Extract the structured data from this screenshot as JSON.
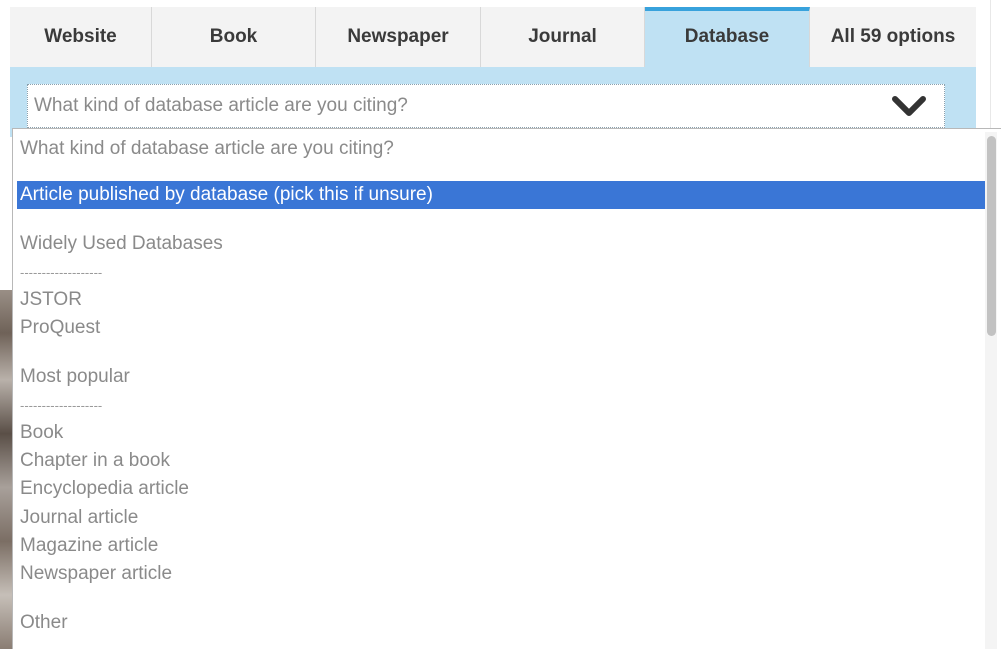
{
  "tabs": [
    {
      "label": "Website",
      "active": false
    },
    {
      "label": "Book",
      "active": false
    },
    {
      "label": "Newspaper",
      "active": false
    },
    {
      "label": "Journal",
      "active": false
    },
    {
      "label": "Database",
      "active": true
    },
    {
      "label": "All 59 options",
      "active": false
    }
  ],
  "select": {
    "placeholder": "What kind of database article are you citing?"
  },
  "dropdown": {
    "placeholder_option": "What kind of database article are you citing?",
    "selected_option": "Article published by database (pick this if unsure)",
    "group_widely_used": "Widely Used Databases",
    "separator_1": "-------------------",
    "jstor": "JSTOR",
    "proquest": "ProQuest",
    "group_most_popular": "Most popular",
    "separator_2": "-------------------",
    "book": "Book",
    "chapter": "Chapter in a book",
    "encyclopedia": "Encyclopedia article",
    "journal_article": "Journal article",
    "magazine_article": "Magazine article",
    "newspaper_article": "Newspaper article",
    "group_other": "Other"
  },
  "colors": {
    "active_tab_bg": "#bfe1f3",
    "active_tab_border": "#38a2dc",
    "selected_option_bg": "#3a76d6"
  },
  "icons": {
    "dropdown": "chevron-down-icon"
  }
}
